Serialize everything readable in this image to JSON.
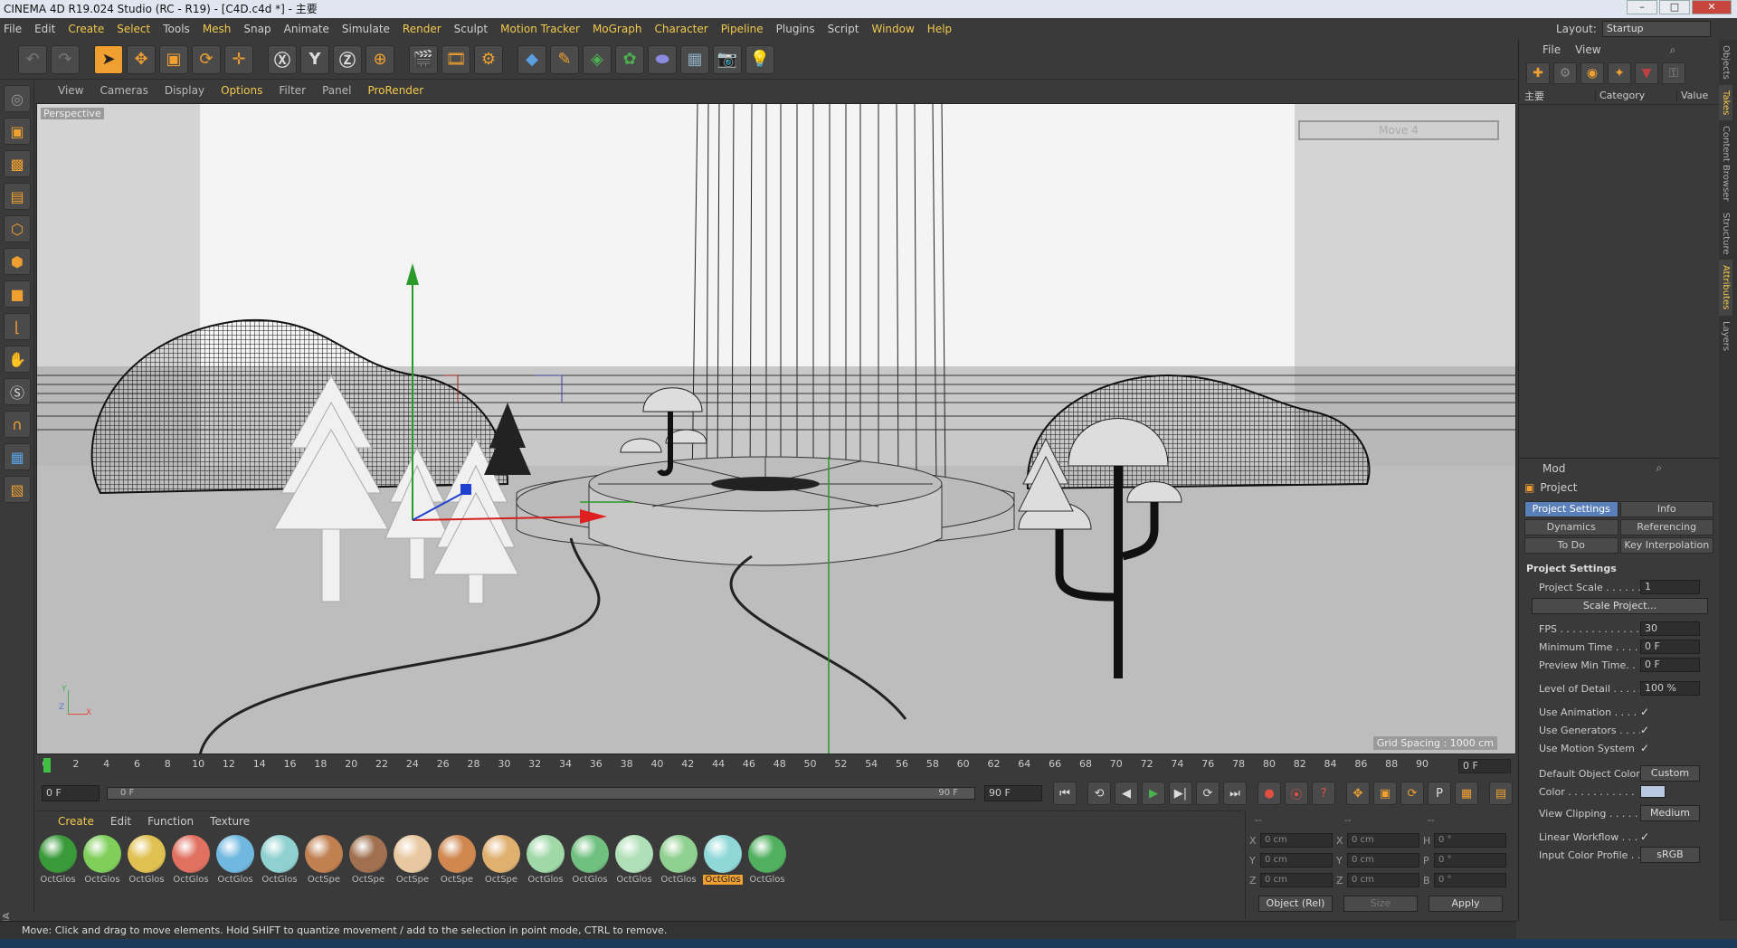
{
  "title": "CINEMA 4D R19.024 Studio (RC - R19) - [C4D.c4d *] - 主要",
  "menu": [
    "File",
    "Edit",
    "Create",
    "Select",
    "Tools",
    "Mesh",
    "Snap",
    "Animate",
    "Simulate",
    "Render",
    "Sculpt",
    "Motion Tracker",
    "MoGraph",
    "Character",
    "Pipeline",
    "Plugins",
    "Script",
    "Window",
    "Help"
  ],
  "layout": {
    "label": "Layout:",
    "value": "Startup"
  },
  "viewport": {
    "menu": [
      "View",
      "Cameras",
      "Display",
      "Options",
      "Filter",
      "Panel",
      "ProRender"
    ],
    "label": "Perspective",
    "move_label": "Move 4",
    "grid_spacing": "Grid Spacing : 1000 cm",
    "axis_y": "Y",
    "axis_z": "Z",
    "axis_x": "X"
  },
  "timeline": {
    "ticks": [
      "0",
      "2",
      "4",
      "6",
      "8",
      "10",
      "12",
      "14",
      "16",
      "18",
      "20",
      "22",
      "24",
      "26",
      "28",
      "30",
      "32",
      "34",
      "36",
      "38",
      "40",
      "42",
      "44",
      "46",
      "48",
      "50",
      "52",
      "54",
      "56",
      "58",
      "60",
      "62",
      "64",
      "66",
      "68",
      "70",
      "72",
      "74",
      "76",
      "78",
      "80",
      "82",
      "84",
      "86",
      "88",
      "90"
    ],
    "current": "0 F"
  },
  "transport": {
    "start": "0 F",
    "slider_start": "0 F",
    "slider_end": "90 F",
    "end": "90 F"
  },
  "materials": {
    "menu": [
      "Create",
      "Edit",
      "Function",
      "Texture"
    ],
    "items": [
      {
        "name": "OctGlos",
        "color": "#3a9a3a"
      },
      {
        "name": "OctGlos",
        "color": "#7fcf5a"
      },
      {
        "name": "OctGlos",
        "color": "#e0c050"
      },
      {
        "name": "OctGlos",
        "color": "#e07060"
      },
      {
        "name": "OctGlos",
        "color": "#70b8e0"
      },
      {
        "name": "OctGlos",
        "color": "#8fd0d0"
      },
      {
        "name": "OctSpe",
        "color": "#c08050"
      },
      {
        "name": "OctSpe",
        "color": "#a07050"
      },
      {
        "name": "OctSpe",
        "color": "#e8c8a0"
      },
      {
        "name": "OctSpe",
        "color": "#d08850"
      },
      {
        "name": "OctSpe",
        "color": "#e0b070"
      },
      {
        "name": "OctGlos",
        "color": "#a0d8a8"
      },
      {
        "name": "OctGlos",
        "color": "#70c080"
      },
      {
        "name": "OctGlos",
        "color": "#b0e0b8"
      },
      {
        "name": "OctGlos",
        "color": "#90d090"
      },
      {
        "name": "OctGlos",
        "color": "#90d8d8"
      },
      {
        "name": "OctGlos",
        "color": "#50b060"
      }
    ],
    "selected_index": 15
  },
  "coords": {
    "rows": [
      {
        "a": "X",
        "av": "0 cm",
        "b": "X",
        "bv": "0 cm",
        "c": "H",
        "cv": "0 °"
      },
      {
        "a": "Y",
        "av": "0 cm",
        "b": "Y",
        "bv": "0 cm",
        "c": "P",
        "cv": "0 °"
      },
      {
        "a": "Z",
        "av": "0 cm",
        "b": "Z",
        "bv": "0 cm",
        "c": "B",
        "cv": "0 °"
      }
    ],
    "mode": "Object (Rel)",
    "size": "Size",
    "apply": "Apply"
  },
  "status": "Move: Click and drag to move elements. Hold SHIFT to quantize movement / add to the selection in point mode, CTRL to remove.",
  "objects": {
    "menu": [
      "File",
      "View"
    ],
    "col_name": "主要",
    "col_category": "Category",
    "col_value": "Value"
  },
  "attributes": {
    "menu": "Mod",
    "title": "Project",
    "tabs": [
      "Project Settings",
      "Info",
      "Dynamics",
      "Referencing",
      "To Do",
      "Key Interpolation"
    ],
    "section": "Project Settings",
    "project_scale": {
      "k": "Project Scale . . . . . .",
      "v": "1"
    },
    "scale_btn": "Scale Project...",
    "fields": [
      {
        "k": "FPS . . . . . . . . . . . . .",
        "v": "30"
      },
      {
        "k": "Minimum Time . . . .",
        "v": "0 F"
      },
      {
        "k": "Preview Min Time. .",
        "v": "0 F"
      }
    ],
    "lod": {
      "k": "Level of Detail . . . . .",
      "v": "100 %"
    },
    "checks": [
      {
        "k": "Use Animation . . . . .",
        "v": "✓"
      },
      {
        "k": "Use Generators . . . .",
        "v": "✓"
      },
      {
        "k": "Use Motion System",
        "v": "✓"
      }
    ],
    "doc": {
      "k": "Default Object Color",
      "v": "Custom"
    },
    "color": {
      "k": "Color . . . . . . . . . . ."
    },
    "clipping": {
      "k": "View Clipping . . . . . .",
      "v": "Medium"
    },
    "linear": {
      "k": "Linear Workflow . . .",
      "v": "✓"
    },
    "profile": {
      "k": "Input Color Profile . .",
      "v": "sRGB"
    }
  },
  "side_tabs": [
    "Objects",
    "Takes",
    "Content Browser",
    "Structure",
    "Attributes",
    "Layers"
  ]
}
